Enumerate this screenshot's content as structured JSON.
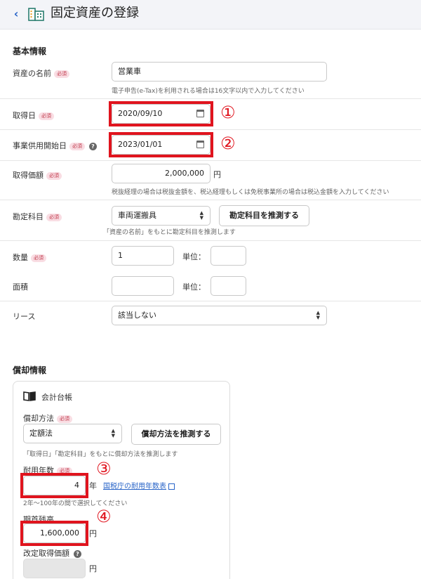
{
  "header": {
    "back_icon": "chevron-left-icon",
    "app_icon": "building-icon",
    "title": "固定資産の登録"
  },
  "basic": {
    "section_title": "基本情報",
    "required_badge": "必須",
    "name": {
      "label": "資産の名前",
      "value": "営業車",
      "hint": "電子申告(e-Tax)を利用される場合は16文字以内で入力してください"
    },
    "acquired_date": {
      "label": "取得日",
      "value": "2020/09/10"
    },
    "start_date": {
      "label": "事業供用開始日",
      "value": "2023/01/01"
    },
    "price": {
      "label": "取得価額",
      "value": "2,000,000",
      "unit": "円",
      "hint": "税抜経理の場合は税抜金額を、税込経理もしくは免税事業所の場合は税込金額を入力してください"
    },
    "account": {
      "label": "勘定科目",
      "value": "車両運搬具",
      "button": "勘定科目を推測する",
      "hint": "「資産の名前」をもとに勘定科目を推測します"
    },
    "quantity": {
      "label": "数量",
      "value": "1",
      "unit_label": "単位：",
      "unit_value": ""
    },
    "area": {
      "label": "面積",
      "value": "",
      "unit_label": "単位：",
      "unit_value": ""
    },
    "lease": {
      "label": "リース",
      "value": "該当しない"
    }
  },
  "depreciation": {
    "section_title": "償却情報",
    "card_title": "会計台帳",
    "method": {
      "label": "償却方法",
      "value": "定額法",
      "button": "償却方法を推測する",
      "hint": "「取得日」「勘定科目」をもとに償却方法を推測します"
    },
    "useful_life": {
      "label": "耐用年数",
      "value": "4",
      "unit": "年",
      "link": "国税庁の耐用年数表",
      "hint": "2年〜100年の間で選択してください"
    },
    "opening_balance": {
      "label": "期首残高",
      "value": "1,600,000",
      "unit": "円"
    },
    "revised_price": {
      "label": "改定取得価額",
      "value": "",
      "unit": "円"
    }
  },
  "annotations": [
    "①",
    "②",
    "③",
    "④"
  ],
  "colors": {
    "accent": "#2864c8",
    "annotation": "#e0141e",
    "badge_bg": "#f9dde3",
    "badge_text": "#c0394b"
  }
}
